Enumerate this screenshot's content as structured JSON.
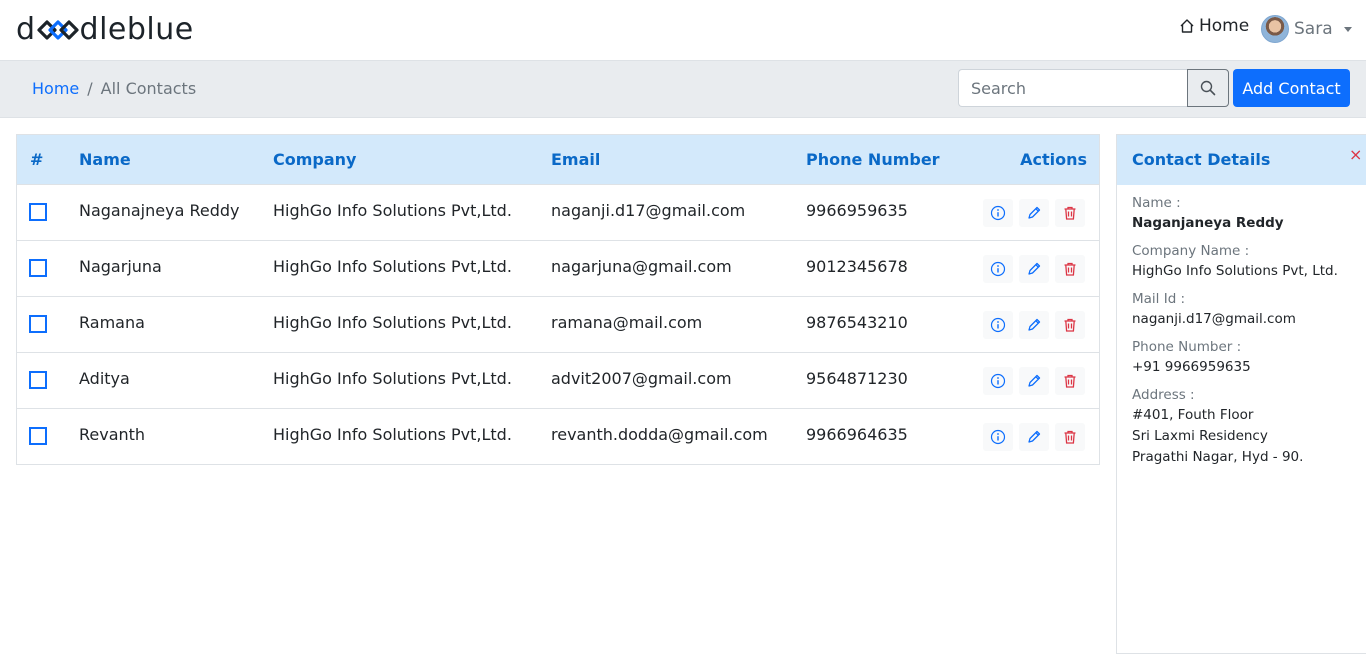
{
  "brand": {
    "logo_text_left": "d",
    "logo_text_right": "dleblue",
    "brand_color": "#1c2329",
    "accent_color": "#0d6efd"
  },
  "nav": {
    "home_label": "Home",
    "home_icon": "house-icon",
    "user_name": "Sara"
  },
  "breadcrumb": {
    "home": "Home",
    "separator": "/",
    "current": "All Contacts"
  },
  "search": {
    "placeholder": "Search",
    "value": ""
  },
  "toolbar": {
    "add_label": "Add Contact"
  },
  "table": {
    "headers": {
      "index": "#",
      "name": "Name",
      "company": "Company",
      "email": "Email",
      "phone": "Phone Number",
      "actions": "Actions"
    },
    "rows": [
      {
        "name": "Naganajneya Reddy",
        "company": "HighGo Info Solutions Pvt,Ltd.",
        "email": "naganji.d17@gmail.com",
        "phone": "9966959635"
      },
      {
        "name": "Nagarjuna",
        "company": "HighGo Info Solutions Pvt,Ltd.",
        "email": "nagarjuna@gmail.com",
        "phone": "9012345678"
      },
      {
        "name": "Ramana",
        "company": "HighGo Info Solutions Pvt,Ltd.",
        "email": "ramana@mail.com",
        "phone": "9876543210"
      },
      {
        "name": "Aditya",
        "company": "HighGo Info Solutions Pvt,Ltd.",
        "email": "advit2007@gmail.com",
        "phone": "9564871230"
      },
      {
        "name": "Revanth",
        "company": "HighGo Info Solutions Pvt,Ltd.",
        "email": "revanth.dodda@gmail.com",
        "phone": "9966964635"
      }
    ]
  },
  "details": {
    "title": "Contact Details",
    "close": "×",
    "name_label": "Name :",
    "name_value": "Naganjaneya Reddy",
    "company_label": "Company Name :",
    "company_value": "HighGo Info Solutions Pvt, Ltd.",
    "mail_label": "Mail Id :",
    "mail_value": "naganji.d17@gmail.com",
    "phone_label": "Phone Number :",
    "phone_value": "+91 9966959635",
    "address_label": "Address :",
    "address_line1": "#401, Fouth Floor",
    "address_line2": "Sri Laxmi Residency",
    "address_line3": "Pragathi Nagar, Hyd - 90."
  }
}
